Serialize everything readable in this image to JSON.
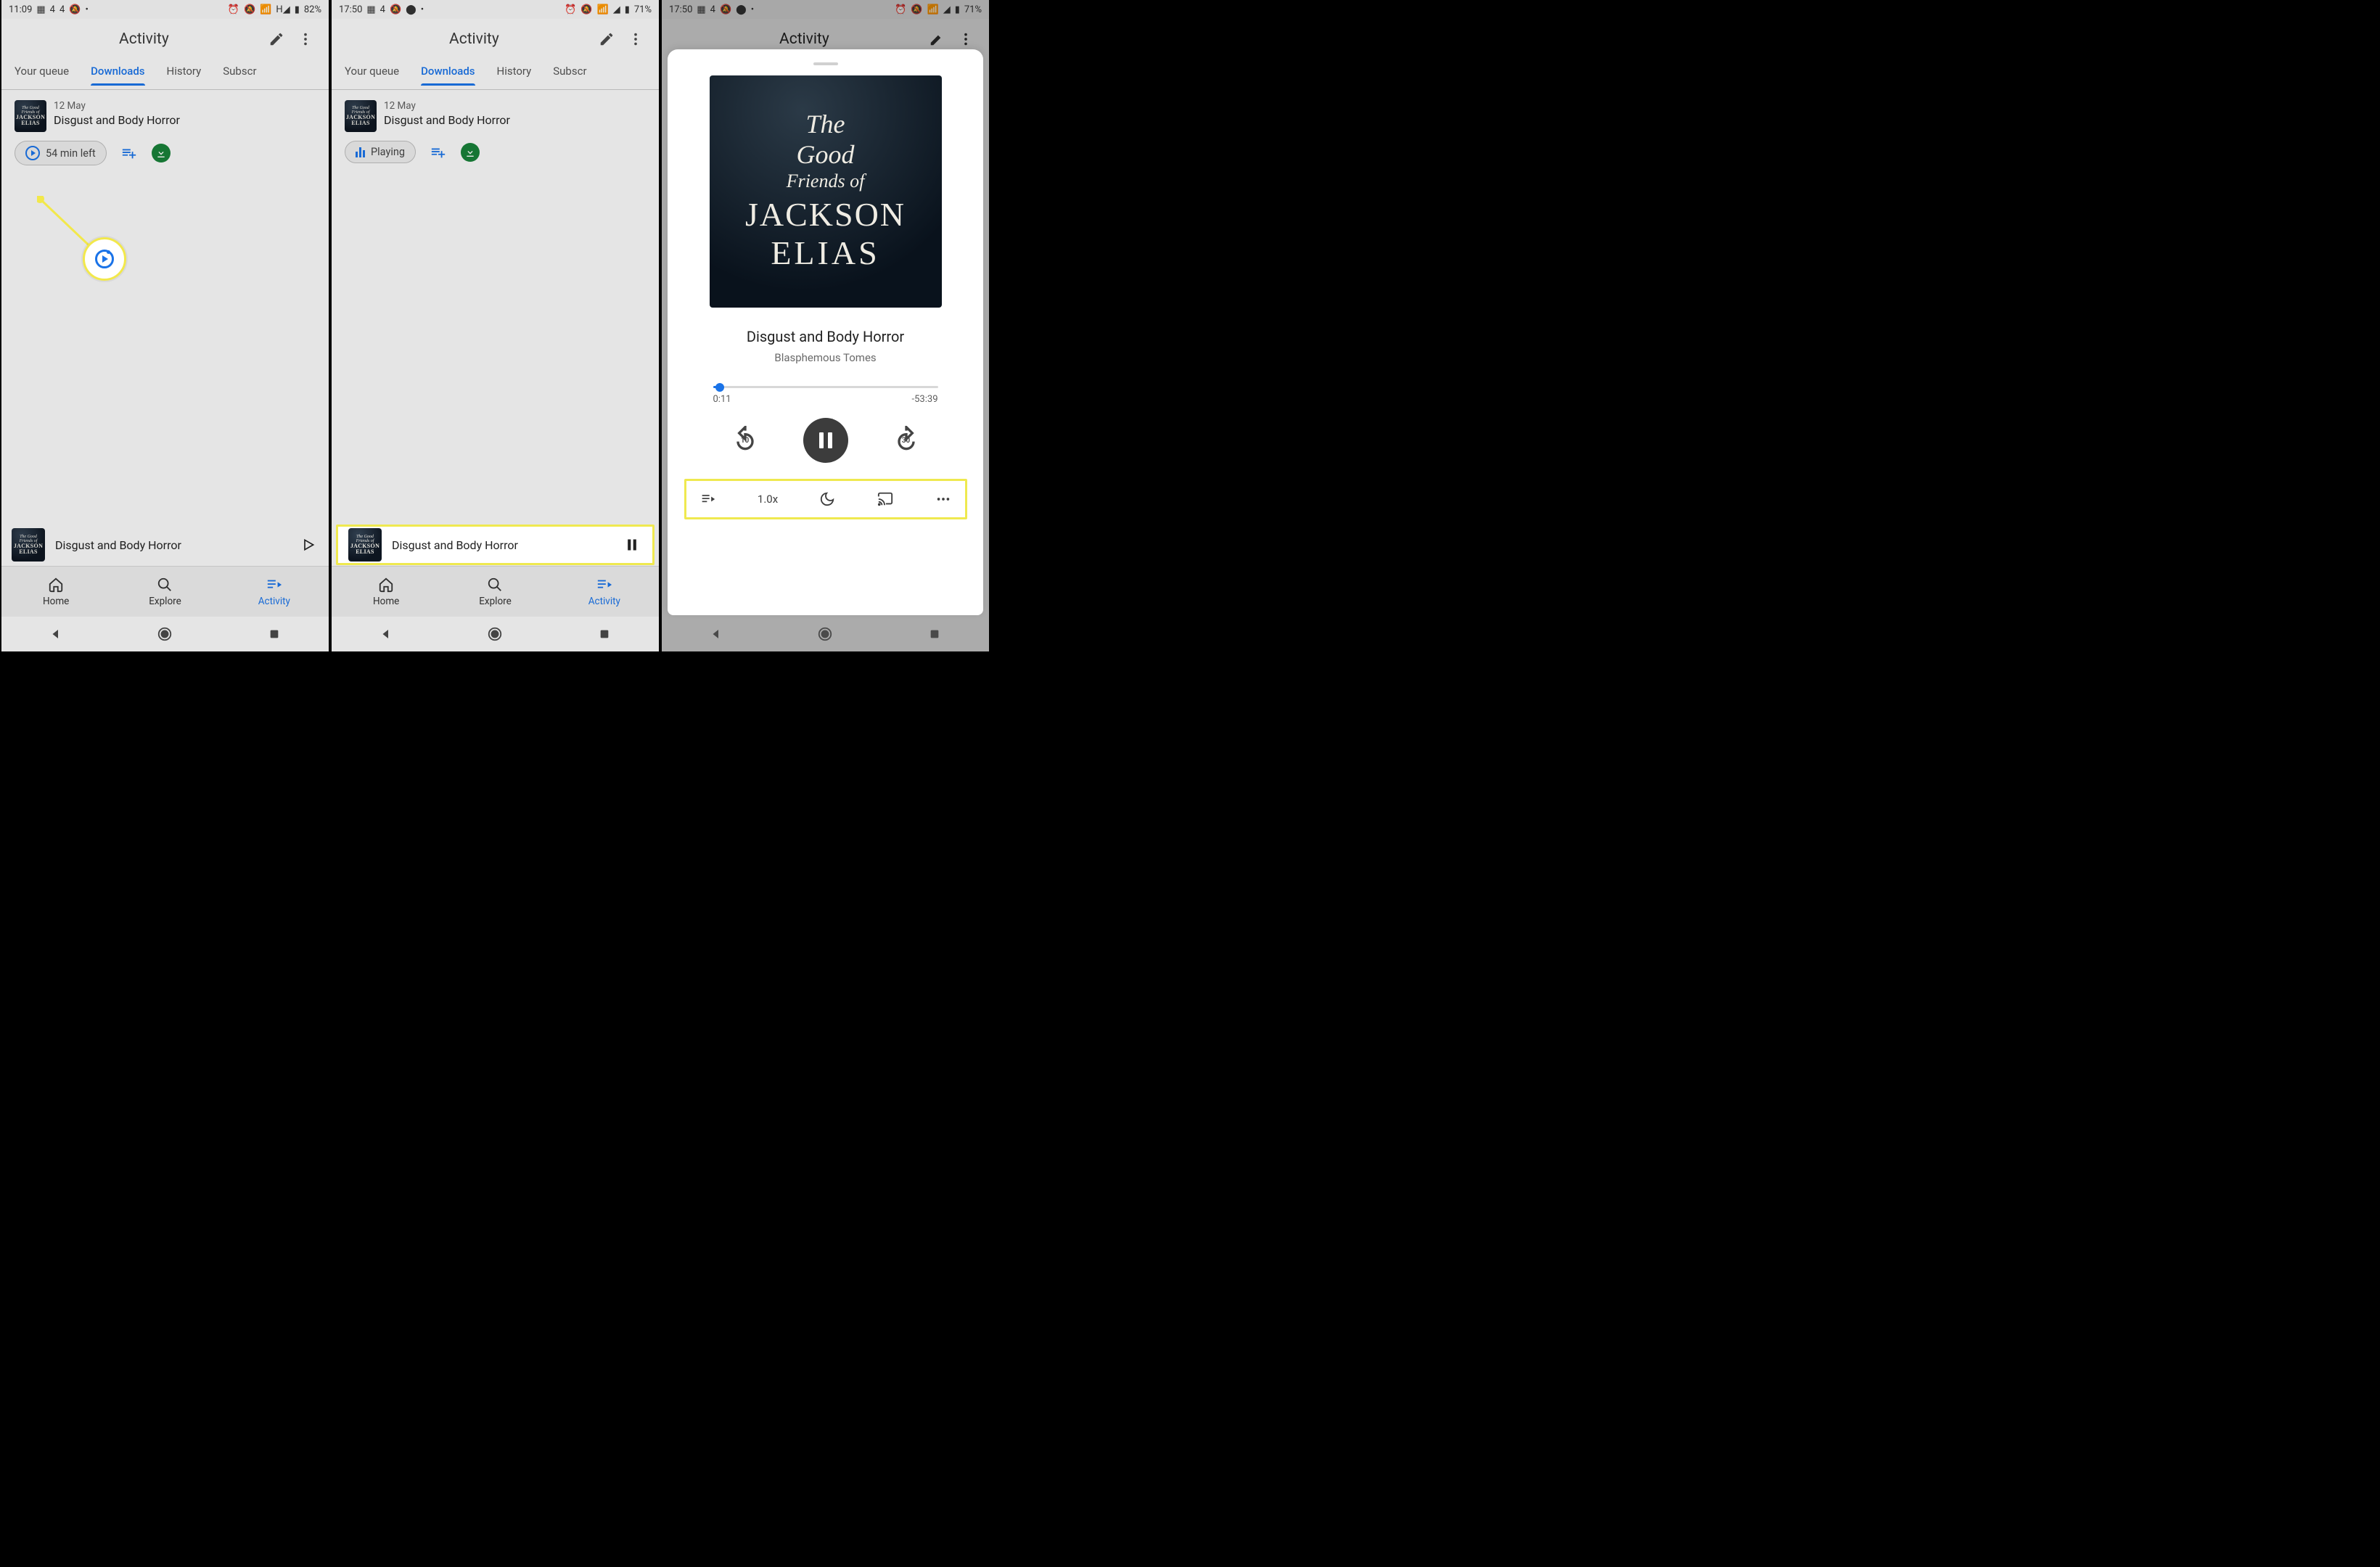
{
  "status": {
    "s1": {
      "time": "11:09",
      "battery": "82%"
    },
    "s2": {
      "time": "17:50",
      "battery": "71%"
    },
    "s3": {
      "time": "17:50",
      "battery": "71%"
    }
  },
  "titlebar": {
    "title": "Activity"
  },
  "tabs": {
    "queue": "Your queue",
    "downloads": "Downloads",
    "history": "History",
    "subs": "Subscr"
  },
  "episode": {
    "date": "12 May",
    "title": "Disgust and Body Horror",
    "time_left": "54 min left",
    "playing": "Playing"
  },
  "miniplayer": {
    "title": "Disgust and Body Horror"
  },
  "bottomnav": {
    "home": "Home",
    "explore": "Explore",
    "activity": "Activity"
  },
  "art": {
    "line1": "The",
    "line2": "Good",
    "line3": "Friends of",
    "line4": "JACKSON",
    "line5": "ELIAS"
  },
  "nowplaying": {
    "title": "Disgust and Body Horror",
    "subtitle": "Blasphemous Tomes",
    "elapsed": "0:11",
    "remaining": "-53:39",
    "speed": "1.0x",
    "back_amount": "10",
    "fwd_amount": "30"
  }
}
